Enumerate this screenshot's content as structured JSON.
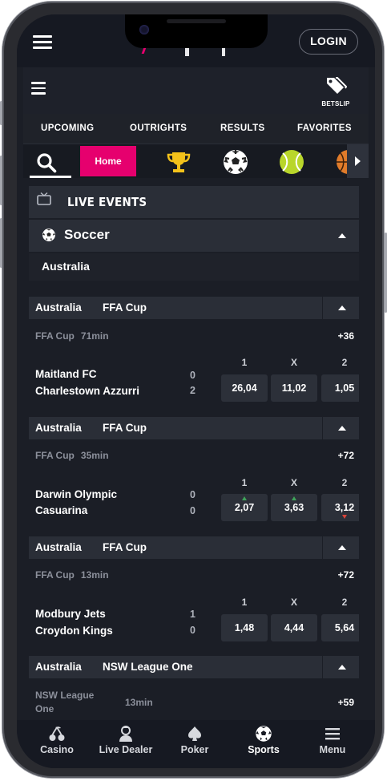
{
  "header": {
    "login_label": "LOGIN",
    "betslip_label": "BETSLIP"
  },
  "tabs": [
    {
      "label": "UPCOMING"
    },
    {
      "label": "OUTRIGHTS"
    },
    {
      "label": "RESULTS"
    },
    {
      "label": "FAVORITES"
    }
  ],
  "sports_bar": {
    "home_label": "Home",
    "icons": [
      "search-icon",
      "trophy-icon",
      "soccer-ball-icon",
      "tennis-ball-icon",
      "basketball-icon"
    ]
  },
  "live": {
    "title": "LIVE EVENTS",
    "sport": "Soccer",
    "region": "Australia"
  },
  "col_labels": {
    "home": "1",
    "draw": "X",
    "away": "2"
  },
  "events": [
    {
      "country": "Australia",
      "competition": "FFA Cup",
      "meta_comp": "FFA Cup",
      "time": "71min",
      "more": "+36",
      "team1": "Maitland FC",
      "team2": "Charlestown Azzurri",
      "score1": "0",
      "score2": "2",
      "odds": [
        "26,04",
        "11,02",
        "1,05"
      ]
    },
    {
      "country": "Australia",
      "competition": "FFA Cup",
      "meta_comp": "FFA Cup",
      "time": "35min",
      "more": "+72",
      "team1": "Darwin Olympic",
      "team2": "Casuarina",
      "score1": "0",
      "score2": "0",
      "odds": [
        "2,07",
        "3,63",
        "3,12"
      ]
    },
    {
      "country": "Australia",
      "competition": "FFA Cup",
      "meta_comp": "FFA Cup",
      "time": "13min",
      "more": "+72",
      "team1": "Modbury Jets",
      "team2": "Croydon Kings",
      "score1": "1",
      "score2": "0",
      "odds": [
        "1,48",
        "4,44",
        "5,64"
      ]
    },
    {
      "country": "Australia",
      "competition": "NSW League One",
      "meta_comp_line1": "NSW League",
      "meta_comp_line2": "One",
      "time": "13min",
      "more": "+59"
    }
  ],
  "bottom_nav": [
    {
      "label": "Casino",
      "icon": "cherries-icon"
    },
    {
      "label": "Live Dealer",
      "icon": "dealer-icon"
    },
    {
      "label": "Poker",
      "icon": "spade-icon"
    },
    {
      "label": "Sports",
      "icon": "soccer-ball-icon",
      "active": true
    },
    {
      "label": "Menu",
      "icon": "menu-icon"
    }
  ],
  "colors": {
    "accent": "#e6006e",
    "background": "#1b1e26",
    "odd_up": "#3ea35a",
    "odd_down": "#d9443a"
  }
}
